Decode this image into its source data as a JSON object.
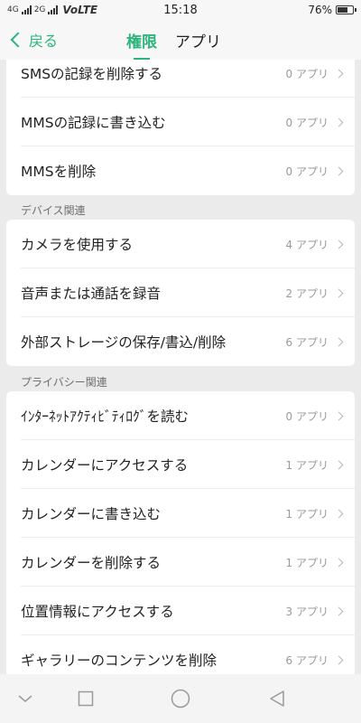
{
  "status_bar": {
    "network_left": "4G",
    "network_right": "2G",
    "volte": "VoLTE",
    "time": "15:18",
    "battery_text": "76%",
    "battery_level": 0.76
  },
  "header": {
    "back_label": "戻る",
    "tabs": [
      {
        "label": "権限",
        "active": true
      },
      {
        "label": "アプリ",
        "active": false
      }
    ]
  },
  "groups": [
    {
      "title": "",
      "items": [
        {
          "label": "SMSの記録を削除する",
          "count": "0 アプリ"
        },
        {
          "label": "MMSの記録に書き込む",
          "count": "0 アプリ"
        },
        {
          "label": "MMSを削除",
          "count": "0 アプリ"
        }
      ]
    },
    {
      "title": "デバイス関連",
      "items": [
        {
          "label": "カメラを使用する",
          "count": "4 アプリ"
        },
        {
          "label": "音声または通話を録音",
          "count": "2 アプリ"
        },
        {
          "label": "外部ストレージの保存/書込/削除",
          "count": "6 アプリ"
        }
      ]
    },
    {
      "title": "プライバシー関連",
      "items": [
        {
          "label": "ｲﾝﾀｰﾈｯﾄｱｸﾃｨﾋﾞﾃｨﾛｸﾞを読む",
          "count": "0 アプリ"
        },
        {
          "label": "カレンダーにアクセスする",
          "count": "1 アプリ"
        },
        {
          "label": "カレンダーに書き込む",
          "count": "1 アプリ"
        },
        {
          "label": "カレンダーを削除する",
          "count": "1 アプリ"
        },
        {
          "label": "位置情報にアクセスする",
          "count": "3 アプリ"
        },
        {
          "label": "ギャラリーのコンテンツを削除",
          "count": "6 アプリ"
        }
      ]
    }
  ],
  "nav": {
    "buttons": [
      "collapse-icon",
      "recents-icon",
      "home-icon",
      "back-icon"
    ]
  },
  "colors": {
    "accent": "#2bb57a",
    "background": "#ebebeb",
    "card": "#ffffff"
  }
}
